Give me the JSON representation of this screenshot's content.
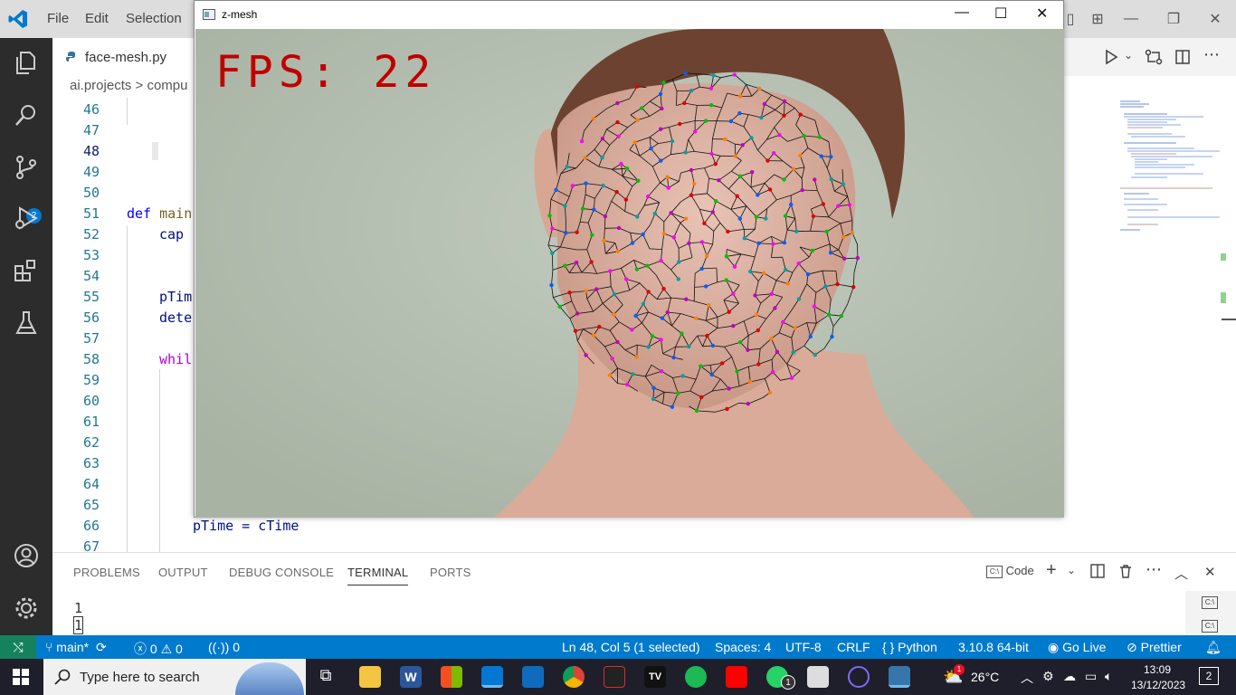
{
  "titlebar": {
    "menu": [
      "File",
      "Edit",
      "Selection"
    ]
  },
  "editor": {
    "tab_label": "face-mesh.py",
    "breadcrumb": "ai.projects > compu",
    "line_numbers": [
      "46",
      "47",
      "48",
      "49",
      "50",
      "51",
      "52",
      "53",
      "54",
      "55",
      "56",
      "57",
      "58",
      "59",
      "60",
      "61",
      "62",
      "63",
      "64",
      "65",
      "66",
      "67"
    ],
    "active_line": "48",
    "code": {
      "def_kw": "def",
      "main_fn": "main",
      "cap": "cap",
      "ptime": "pTim",
      "dete": "dete",
      "while_kw": "whil",
      "ptime_assign": "pTime = cTime"
    }
  },
  "activity": {
    "scm_badge": "2"
  },
  "panel": {
    "tabs": [
      "PROBLEMS",
      "OUTPUT",
      "DEBUG CONSOLE",
      "TERMINAL",
      "PORTS"
    ],
    "active_tab": "TERMINAL",
    "terminal_profile": "Code",
    "terminal_lines": [
      "1",
      "1"
    ]
  },
  "statusbar": {
    "branch": "main*",
    "errors": "0",
    "warnings": "0",
    "ports": "0",
    "cursor": "Ln 48, Col 5 (1 selected)",
    "spaces": "Spaces: 4",
    "encoding": "UTF-8",
    "eol": "CRLF",
    "language": "Python",
    "interpreter": "3.10.8 64-bit",
    "golive": "Go Live",
    "prettier": "Prettier"
  },
  "cv_window": {
    "title": "z-mesh",
    "fps_text": "FPS: 22"
  },
  "taskbar": {
    "search_placeholder": "Type here to search",
    "whatsapp_badge": "1",
    "weather_badge": "1",
    "temperature": "26°C",
    "time": "13:09",
    "date": "13/12/2023",
    "notifications": "2"
  },
  "colors": {
    "statusbar": "#007acc",
    "remote": "#16825d",
    "fps_text": "#c00000",
    "activitybar": "#2c2c2c"
  }
}
